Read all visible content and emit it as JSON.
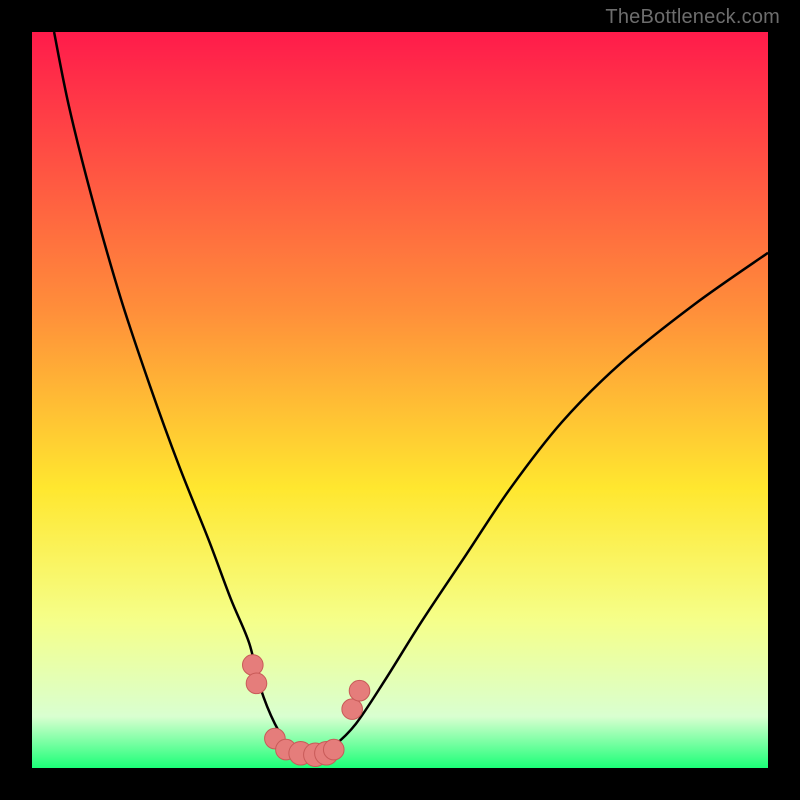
{
  "watermark": {
    "text": "TheBottleneck.com"
  },
  "colors": {
    "gradient_top": "#ff1b4b",
    "gradient_mid_upper": "#ff8f3a",
    "gradient_mid": "#ffe72f",
    "gradient_lower": "#f5ff8a",
    "gradient_pale": "#d9ffd0",
    "gradient_bottom": "#1bff77",
    "curve": "#000000",
    "marker_fill": "#e57d7b",
    "marker_stroke": "#c85a58",
    "frame": "#000000"
  },
  "chart_data": {
    "type": "line",
    "title": "",
    "xlabel": "",
    "ylabel": "",
    "xlim": [
      0,
      100
    ],
    "ylim": [
      0,
      100
    ],
    "grid": false,
    "legend": false,
    "series": [
      {
        "name": "bottleneck-curve",
        "x": [
          3,
          5,
          8,
          12,
          16,
          20,
          24,
          27,
          29.5,
          31,
          33,
          35,
          37,
          39,
          41,
          44,
          48,
          53,
          59,
          65,
          72,
          80,
          90,
          100
        ],
        "y": [
          100,
          90,
          78,
          64,
          52,
          41,
          31,
          23,
          17,
          11,
          6,
          3,
          2,
          2,
          3,
          6,
          12,
          20,
          29,
          38,
          47,
          55,
          63,
          70
        ]
      }
    ],
    "markers": [
      {
        "name": "point-a",
        "x": 30.0,
        "y": 14.0,
        "r": 1.4
      },
      {
        "name": "point-b",
        "x": 30.5,
        "y": 11.5,
        "r": 1.4
      },
      {
        "name": "point-c",
        "x": 33.0,
        "y": 4.0,
        "r": 1.4
      },
      {
        "name": "point-d",
        "x": 34.5,
        "y": 2.5,
        "r": 1.4
      },
      {
        "name": "point-e",
        "x": 36.5,
        "y": 2.0,
        "r": 1.6
      },
      {
        "name": "point-f",
        "x": 38.5,
        "y": 1.8,
        "r": 1.6
      },
      {
        "name": "point-g",
        "x": 40.0,
        "y": 2.0,
        "r": 1.6
      },
      {
        "name": "point-h",
        "x": 41.0,
        "y": 2.5,
        "r": 1.4
      },
      {
        "name": "point-i",
        "x": 43.5,
        "y": 8.0,
        "r": 1.4
      },
      {
        "name": "point-j",
        "x": 44.5,
        "y": 10.5,
        "r": 1.4
      }
    ],
    "gradient_stops": [
      {
        "offset": 0.0,
        "color_key": "gradient_top"
      },
      {
        "offset": 0.38,
        "color_key": "gradient_mid_upper"
      },
      {
        "offset": 0.62,
        "color_key": "gradient_mid"
      },
      {
        "offset": 0.8,
        "color_key": "gradient_lower"
      },
      {
        "offset": 0.93,
        "color_key": "gradient_pale"
      },
      {
        "offset": 1.0,
        "color_key": "gradient_bottom"
      }
    ]
  }
}
